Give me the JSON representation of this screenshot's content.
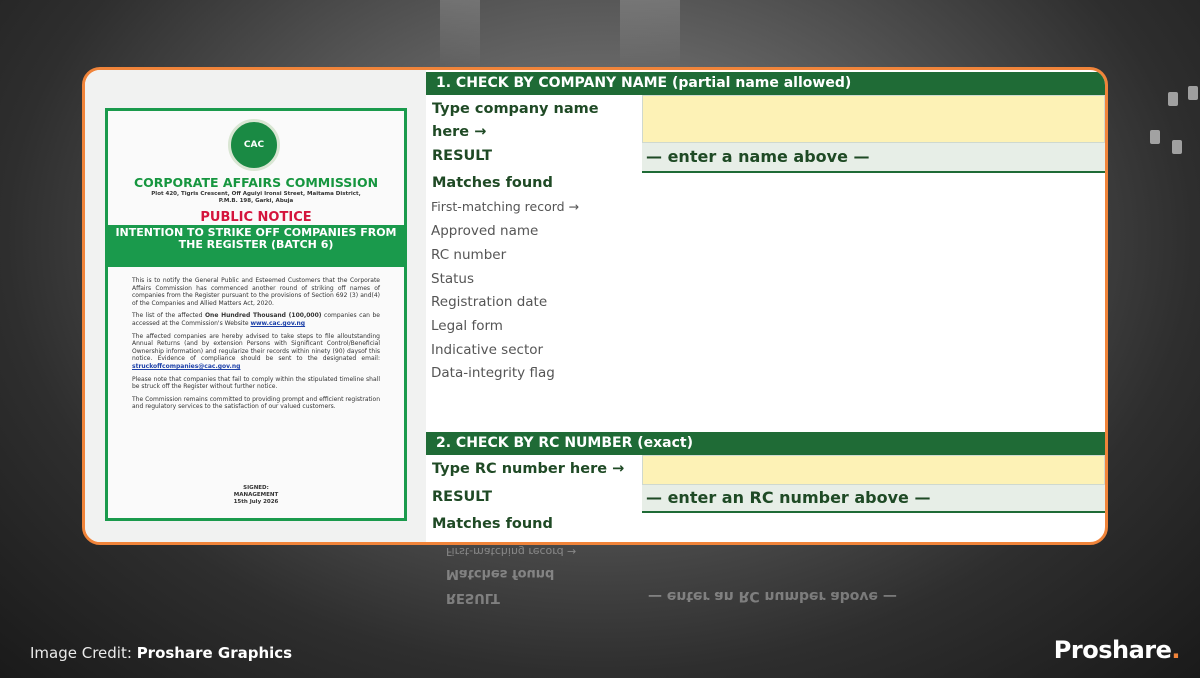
{
  "notice": {
    "seal_text": "CAC",
    "org": "CORPORATE AFFAIRS COMMISSION",
    "address": "Plot 420, Tigris Crescent, Off Aguiyi Ironsi Street, Maitama District, P.M.B. 198, Garki, Abuja",
    "public_notice": "PUBLIC NOTICE",
    "headline": "INTENTION TO STRIKE OFF COMPANIES FROM THE REGISTER (BATCH 6)",
    "para1": "This is to notify the General Public and Esteemed Customers that the Corporate Affairs Commission has commenced another round of striking off names of companies from the Register pursuant to the provisions of Section 692 (3) and(4) of the Companies and Allied Matters Act, 2020.",
    "para2_a": "The list of the affected ",
    "para2_bold": "One Hundred Thousand (100,000)",
    "para2_b": " companies can be accessed at the Commission's Website ",
    "para2_link": "www.cac.gov.ng",
    "para3": "The affected companies are hereby advised to take steps to file alloutstanding Annual Returns (and by extension Persons with Significant Control/Beneficial Ownership information) and regularize their records within ninety (90) daysof this notice. Evidence of compliance should be sent to the designated email:",
    "para3_email": "struckoffcompanies@cac.gov.ng",
    "para4": "Please note that companies that fail to comply within the stipulated timeline shall be struck off the Register without further notice.",
    "para5": "The Commission remains committed to providing prompt and efficient registration and regulatory services to the satisfaction of our valued customers.",
    "signed": "SIGNED:",
    "signer": "MANAGEMENT",
    "date": "15th July 2026"
  },
  "section1": {
    "header": "1.  CHECK BY COMPANY NAME  (partial name allowed)",
    "input_label_line1": "Type company name",
    "input_label_line2": "here →",
    "input_value": "",
    "result_label": "RESULT",
    "result_value": "— enter a name above —",
    "matches_label": "Matches found",
    "fields": [
      "First-matching record →",
      "Approved name",
      "RC number",
      "Status",
      "Registration date",
      "Legal form",
      "Indicative sector",
      "Data-integrity flag"
    ]
  },
  "section2": {
    "header": "2.  CHECK BY RC NUMBER  (exact)",
    "input_label": "Type RC number here →",
    "input_value": "",
    "result_label": "RESULT",
    "result_value": "— enter an RC number above —",
    "matches_label": "Matches found"
  },
  "reflection": {
    "line1": "First-matching record →",
    "line2": "Matches found",
    "line3": "RESULT",
    "line4": "— enter an RC number above —"
  },
  "footer": {
    "credit_prefix": "Image Credit: ",
    "credit_name": "Proshare Graphics",
    "brand": "Proshare",
    "brand_dot": "."
  },
  "colors": {
    "frame_border": "#f0843a",
    "section_header": "#1f6b36",
    "input_fill": "#fdf2b6",
    "result_fill": "#e7eee7",
    "notice_green": "#1a9a4c",
    "notice_red": "#d4143c"
  }
}
